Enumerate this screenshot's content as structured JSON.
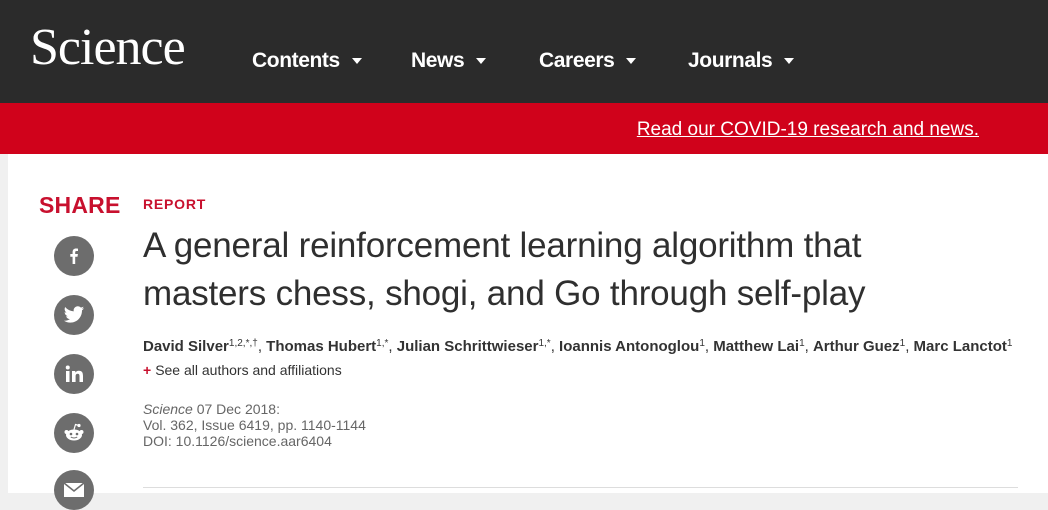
{
  "header": {
    "logo": "Science",
    "nav": [
      "Contents",
      "News",
      "Careers",
      "Journals"
    ]
  },
  "banner": {
    "link_text": "Read our COVID-19 research and news."
  },
  "share": {
    "label": "SHARE",
    "icons": [
      "facebook-icon",
      "twitter-icon",
      "linkedin-icon",
      "reddit-icon",
      "email-icon"
    ]
  },
  "article": {
    "kicker": "REPORT",
    "title": "A general reinforcement learning algorithm that masters chess, shogi, and Go through self-play",
    "authors": [
      {
        "name": "David Silver",
        "sup": "1,2,*,†"
      },
      {
        "name": "Thomas Hubert",
        "sup": "1,*"
      },
      {
        "name": "Julian Schrittwieser",
        "sup": "1,*"
      },
      {
        "name": "Ioannis Antonoglou",
        "sup": "1"
      },
      {
        "name": "Matthew Lai",
        "sup": "1"
      },
      {
        "name": "Arthur Guez",
        "sup": "1"
      },
      {
        "name": "Marc Lanctot",
        "sup": "1"
      }
    ],
    "see_all": "See all authors and affiliations",
    "journal": "Science",
    "date": "07 Dec 2018:",
    "volume": "Vol. 362, Issue 6419, pp. 1140-1144",
    "doi": "DOI: 10.1126/science.aar6404"
  },
  "colors": {
    "header_bg": "#2b2b2b",
    "banner_bg": "#d0021b",
    "accent": "#c8102e",
    "icon_bg": "#6d6d6d"
  }
}
